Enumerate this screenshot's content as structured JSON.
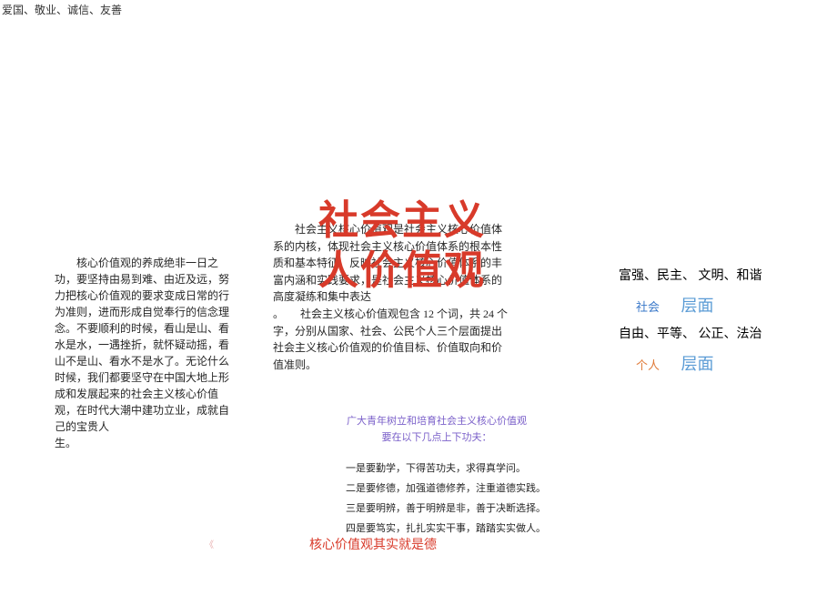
{
  "top_line": "爱国、敬业、诚信、友善",
  "center_title_line1": "社会主义",
  "center_title_line2": "人价值观",
  "center_paragraph": "　　社会主义核心价值观是社会主义核心价值体系的内核，体现社会主义核心价值体系的根本性质和基本特征，反映社会主义核心价值体系的丰富内涵和实践要求，是社会主义核心价值体系的高度凝练和集中表达\n。　　社会主义核心价值观包含 12 个词，共 24 个字，分别从国家、社会、公民个人三个层面提出社会主义核心价值观的价值目标、价值取向和价值准则。",
  "left_paragraph": "　　核心价值观的养成绝非一日之功，要坚持由易到难、由近及远，努力把核心价值观的要求变成日常的行为准则，进而形成自觉奉行的信念理念。不要顺利的时候，看山是山、看水是水，一遇挫折，就怀疑动摇，看山不是山、看水不是水了。无论什么时候，我们都要坚守在中国大地上形成和发展起来的社会主义核心价值观，在时代大潮中建功立业，成就自己的宝贵人\n生。",
  "right": {
    "row1": "富强、民主、 文明、和谐",
    "tag1": "社会",
    "tag1_big": "层面",
    "row2": "自由、平等、 公正、法治",
    "tag2": "个人",
    "tag2_big": "层面"
  },
  "youth": {
    "header_line1": "广大青年树立和培育社会主义核心价值观",
    "header_line2": "要在以下几点上下功夫：",
    "items": [
      "一是要勤学，下得苦功夫，求得真学问。",
      "二是要修德，加强道德修养，注重道德实践。",
      "三是要明辨，善于明辨是非，善于决断选择。",
      "四是要笃实，扎扎实实干事，踏踏实实做人。"
    ]
  },
  "bottom_red": "核心价值观其实就是德",
  "tiny_mark": "《"
}
